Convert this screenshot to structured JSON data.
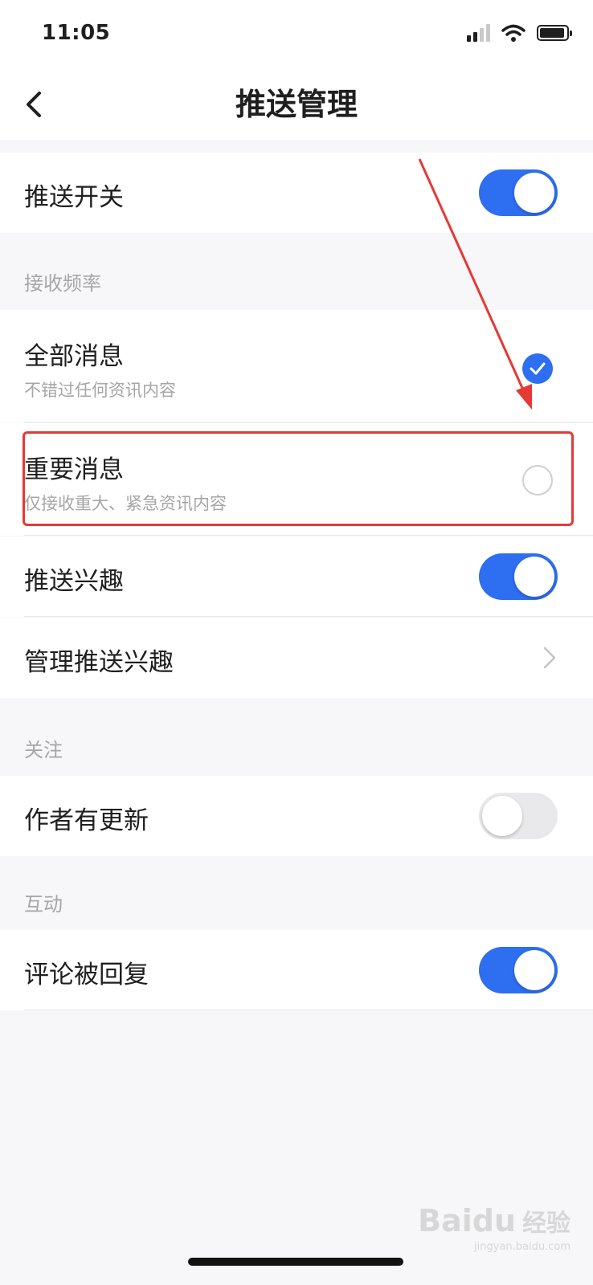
{
  "status_bar": {
    "time": "11:05"
  },
  "header": {
    "title": "推送管理"
  },
  "push_switch": {
    "label": "推送开关",
    "enabled": true
  },
  "frequency": {
    "section_label": "接收频率",
    "options": [
      {
        "title": "全部消息",
        "subtitle": "不错过任何资讯内容",
        "selected": true
      },
      {
        "title": "重要消息",
        "subtitle": "仅接收重大、紧急资讯内容",
        "selected": false
      }
    ]
  },
  "interest": {
    "push_label": "推送兴趣",
    "push_enabled": true,
    "manage_label": "管理推送兴趣"
  },
  "follow": {
    "section_label": "关注",
    "author_update_label": "作者有更新",
    "author_update_enabled": false
  },
  "interaction": {
    "section_label": "互动",
    "comment_reply_label": "评论被回复",
    "comment_reply_enabled": true
  },
  "watermark": {
    "brand": "Baidu",
    "brand_cn": "经验",
    "url": "jingyan.baidu.com"
  },
  "colors": {
    "accent": "#2e6ef0",
    "annotation": "#e53935",
    "background": "#f7f6f8"
  }
}
